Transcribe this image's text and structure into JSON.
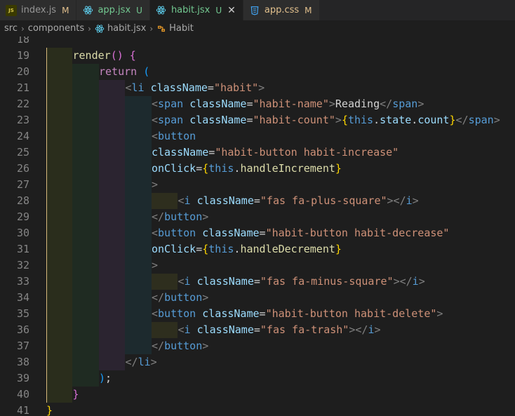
{
  "tabs": [
    {
      "label": "index.js",
      "status": "M",
      "icon": "js-file-icon"
    },
    {
      "label": "app.jsx",
      "status": "U",
      "icon": "react-icon"
    },
    {
      "label": "habit.jsx",
      "status": "U",
      "icon": "react-icon",
      "active": true
    },
    {
      "label": "app.css",
      "status": "M",
      "icon": "css-file-icon"
    }
  ],
  "breadcrumb": {
    "items": [
      "src",
      "components",
      "habit.jsx",
      "Habit"
    ],
    "icon_js": "JS"
  },
  "colors": {
    "tag": "#808080",
    "element": "#569cd6",
    "attribute": "#9cdcfe",
    "string": "#ce9178",
    "function": "#dcdcaa",
    "keyword": "#c586c0",
    "text": "#d4d4d4"
  },
  "lines": [
    {
      "n": "18",
      "depth": 0,
      "tokens": []
    },
    {
      "n": "19",
      "depth": 1,
      "tokens": [
        [
          "t-fn",
          "render"
        ],
        [
          "t-br2",
          "()"
        ],
        [
          "t-p",
          " "
        ],
        [
          "t-br2",
          "{"
        ]
      ]
    },
    {
      "n": "20",
      "depth": 2,
      "tokens": [
        [
          "t-kw",
          "return"
        ],
        [
          "t-p",
          " "
        ],
        [
          "t-br3",
          "("
        ]
      ]
    },
    {
      "n": "21",
      "depth": 3,
      "tokens": [
        [
          "t-tag",
          "<"
        ],
        [
          "t-el",
          "li"
        ],
        [
          "t-p",
          " "
        ],
        [
          "t-attr",
          "className"
        ],
        [
          "t-p",
          "="
        ],
        [
          "t-str",
          "\"habit\""
        ],
        [
          "t-tag",
          ">"
        ]
      ]
    },
    {
      "n": "22",
      "depth": 4,
      "tokens": [
        [
          "t-tag",
          "<"
        ],
        [
          "t-el",
          "span"
        ],
        [
          "t-p",
          " "
        ],
        [
          "t-attr",
          "className"
        ],
        [
          "t-p",
          "="
        ],
        [
          "t-str",
          "\"habit-name\""
        ],
        [
          "t-tag",
          ">"
        ],
        [
          "t-p",
          "Reading"
        ],
        [
          "t-tag",
          "</"
        ],
        [
          "t-el",
          "span"
        ],
        [
          "t-tag",
          ">"
        ]
      ]
    },
    {
      "n": "23",
      "depth": 4,
      "tokens": [
        [
          "t-tag",
          "<"
        ],
        [
          "t-el",
          "span"
        ],
        [
          "t-p",
          " "
        ],
        [
          "t-attr",
          "className"
        ],
        [
          "t-p",
          "="
        ],
        [
          "t-str",
          "\"habit-count\""
        ],
        [
          "t-tag",
          ">"
        ],
        [
          "t-br1",
          "{"
        ],
        [
          "t-this",
          "this"
        ],
        [
          "t-p",
          "."
        ],
        [
          "t-attr",
          "state"
        ],
        [
          "t-p",
          "."
        ],
        [
          "t-attr",
          "count"
        ],
        [
          "t-br1",
          "}"
        ],
        [
          "t-tag",
          "</"
        ],
        [
          "t-el",
          "span"
        ],
        [
          "t-tag",
          ">"
        ]
      ]
    },
    {
      "n": "24",
      "depth": 4,
      "tokens": [
        [
          "t-tag",
          "<"
        ],
        [
          "t-el",
          "button"
        ]
      ]
    },
    {
      "n": "25",
      "depth": 4,
      "tokens": [
        [
          "t-attr",
          "className"
        ],
        [
          "t-p",
          "="
        ],
        [
          "t-str",
          "\"habit-button habit-increase\""
        ]
      ]
    },
    {
      "n": "26",
      "depth": 4,
      "tokens": [
        [
          "t-attr",
          "onClick"
        ],
        [
          "t-p",
          "="
        ],
        [
          "t-br1",
          "{"
        ],
        [
          "t-this",
          "this"
        ],
        [
          "t-p",
          "."
        ],
        [
          "t-fn",
          "handleIncrement"
        ],
        [
          "t-br1",
          "}"
        ]
      ]
    },
    {
      "n": "27",
      "depth": 4,
      "tokens": [
        [
          "t-tag",
          ">"
        ]
      ]
    },
    {
      "n": "28",
      "depth": 5,
      "tokens": [
        [
          "t-tag",
          "<"
        ],
        [
          "t-el",
          "i"
        ],
        [
          "t-p",
          " "
        ],
        [
          "t-attr",
          "className"
        ],
        [
          "t-p",
          "="
        ],
        [
          "t-str",
          "\"fas fa-plus-square\""
        ],
        [
          "t-tag",
          "></"
        ],
        [
          "t-el",
          "i"
        ],
        [
          "t-tag",
          ">"
        ]
      ]
    },
    {
      "n": "29",
      "depth": 4,
      "tokens": [
        [
          "t-tag",
          "</"
        ],
        [
          "t-el",
          "button"
        ],
        [
          "t-tag",
          ">"
        ]
      ]
    },
    {
      "n": "30",
      "depth": 4,
      "tokens": [
        [
          "t-tag",
          "<"
        ],
        [
          "t-el",
          "button"
        ],
        [
          "t-p",
          " "
        ],
        [
          "t-attr",
          "className"
        ],
        [
          "t-p",
          "="
        ],
        [
          "t-str",
          "\"habit-button habit-decrease\""
        ]
      ]
    },
    {
      "n": "31",
      "depth": 4,
      "tokens": [
        [
          "t-attr",
          "onClick"
        ],
        [
          "t-p",
          "="
        ],
        [
          "t-br1",
          "{"
        ],
        [
          "t-this",
          "this"
        ],
        [
          "t-p",
          "."
        ],
        [
          "t-fn",
          "handleDecrement"
        ],
        [
          "t-br1",
          "}"
        ]
      ]
    },
    {
      "n": "32",
      "depth": 4,
      "tokens": [
        [
          "t-tag",
          ">"
        ]
      ]
    },
    {
      "n": "33",
      "depth": 5,
      "tokens": [
        [
          "t-tag",
          "<"
        ],
        [
          "t-el",
          "i"
        ],
        [
          "t-p",
          " "
        ],
        [
          "t-attr",
          "className"
        ],
        [
          "t-p",
          "="
        ],
        [
          "t-str",
          "\"fas fa-minus-square\""
        ],
        [
          "t-tag",
          "></"
        ],
        [
          "t-el",
          "i"
        ],
        [
          "t-tag",
          ">"
        ]
      ]
    },
    {
      "n": "34",
      "depth": 4,
      "tokens": [
        [
          "t-tag",
          "</"
        ],
        [
          "t-el",
          "button"
        ],
        [
          "t-tag",
          ">"
        ]
      ]
    },
    {
      "n": "35",
      "depth": 4,
      "tokens": [
        [
          "t-tag",
          "<"
        ],
        [
          "t-el",
          "button"
        ],
        [
          "t-p",
          " "
        ],
        [
          "t-attr",
          "className"
        ],
        [
          "t-p",
          "="
        ],
        [
          "t-str",
          "\"habit-button habit-delete\""
        ],
        [
          "t-tag",
          ">"
        ]
      ]
    },
    {
      "n": "36",
      "depth": 5,
      "tokens": [
        [
          "t-tag",
          "<"
        ],
        [
          "t-el",
          "i"
        ],
        [
          "t-p",
          " "
        ],
        [
          "t-attr",
          "className"
        ],
        [
          "t-p",
          "="
        ],
        [
          "t-str",
          "\"fas fa-trash\""
        ],
        [
          "t-tag",
          "></"
        ],
        [
          "t-el",
          "i"
        ],
        [
          "t-tag",
          ">"
        ]
      ]
    },
    {
      "n": "37",
      "depth": 4,
      "tokens": [
        [
          "t-tag",
          "</"
        ],
        [
          "t-el",
          "button"
        ],
        [
          "t-tag",
          ">"
        ]
      ]
    },
    {
      "n": "38",
      "depth": 3,
      "tokens": [
        [
          "t-tag",
          "</"
        ],
        [
          "t-el",
          "li"
        ],
        [
          "t-tag",
          ">"
        ]
      ]
    },
    {
      "n": "39",
      "depth": 2,
      "tokens": [
        [
          "t-br3",
          ")"
        ],
        [
          "t-p",
          ";"
        ]
      ]
    },
    {
      "n": "40",
      "depth": 1,
      "tokens": [
        [
          "t-br2",
          "}"
        ]
      ]
    },
    {
      "n": "41",
      "depth": 0,
      "tokens": [
        [
          "t-br1",
          "}"
        ]
      ]
    }
  ]
}
